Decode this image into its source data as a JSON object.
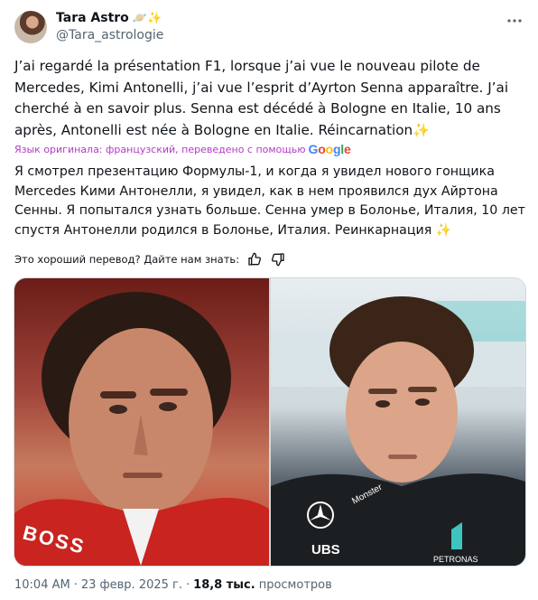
{
  "author": {
    "display_name": "Tara Astro",
    "handle": "@Tara_astrologie",
    "name_emojis": "🪐✨"
  },
  "tweet": {
    "original_text": "J’ai regardé la présentation F1, lorsque j’ai vue le nouveau pilote de Mercedes, Kimi Antonelli, j’ai vue l’esprit d’Ayrton Senna apparaître. J’ai cherché à en savoir plus. Senna est décédé à Bologne en Italie, 10 ans après, Antonelli est née à Bologne en Italie. Réincarnation",
    "original_emoji": "✨",
    "translated_note": "Язык оригинала: французский, переведено с помощью",
    "translator_logo_text": "Google",
    "translated_text": "Я смотрел презентацию Формулы-1, и когда я увидел нового гонщика Mercedes Кими Антонелли, я увидел, как в нем проявился дух Айртона Сенны. Я попытался узнать больше. Сенна умер в Болонье, Италия, 10 лет спустя Антонелли родился в Болонье, Италия. Реинкарнация",
    "translated_emoji": "✨",
    "feedback_prompt": "Это хороший перевод? Дайте нам знать:"
  },
  "media": {
    "left_text": "BOSS",
    "right_texts": [
      "UBS",
      "Monster",
      "PETRONAS"
    ]
  },
  "footer": {
    "time": "10:04 AM",
    "separator": "·",
    "date": "23 февр. 2025 г.",
    "views_count": "18,8 тыс.",
    "views_label": "просмотров"
  },
  "icons": {
    "more": "more-horizontal-icon",
    "thumbs_up": "thumbs-up-icon",
    "thumbs_down": "thumbs-down-icon"
  },
  "colors": {
    "text": "#0f1419",
    "secondary": "#536471",
    "translation_note": "#b23cc5"
  }
}
